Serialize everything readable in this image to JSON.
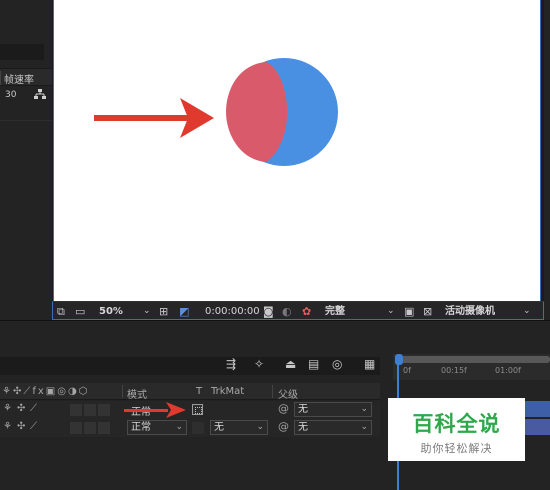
{
  "project_panel": {
    "column_header": "帧速率",
    "row_value": "30",
    "flowchart_icon": "flowchart-icon"
  },
  "viewer": {
    "background": "#ffffff",
    "shapes": {
      "circle_blue": "#4a90e2",
      "circle_red": "#d95b6b",
      "arrow_color": "#e03a2e"
    },
    "toolbar": {
      "zoom": "50%",
      "timecode": "0:00:00:00",
      "resolution": "完整",
      "camera": "活动摄像机"
    }
  },
  "timeline": {
    "ruler_ticks": [
      "0f",
      "00:15f",
      "01:00f"
    ],
    "columns": {
      "mode": "模式",
      "t": "T",
      "trkmat": "TrkMat",
      "parent": "父级"
    },
    "layers": [
      {
        "mode": "正常",
        "parent": "无",
        "trkmat": ""
      },
      {
        "mode": "正常",
        "parent": "无",
        "trkmat": "无"
      }
    ],
    "accent": "#3d7fd6"
  },
  "watermark": {
    "title": "百科全说",
    "subtitle": "助你轻松解决",
    "color": "#2ea84a"
  }
}
